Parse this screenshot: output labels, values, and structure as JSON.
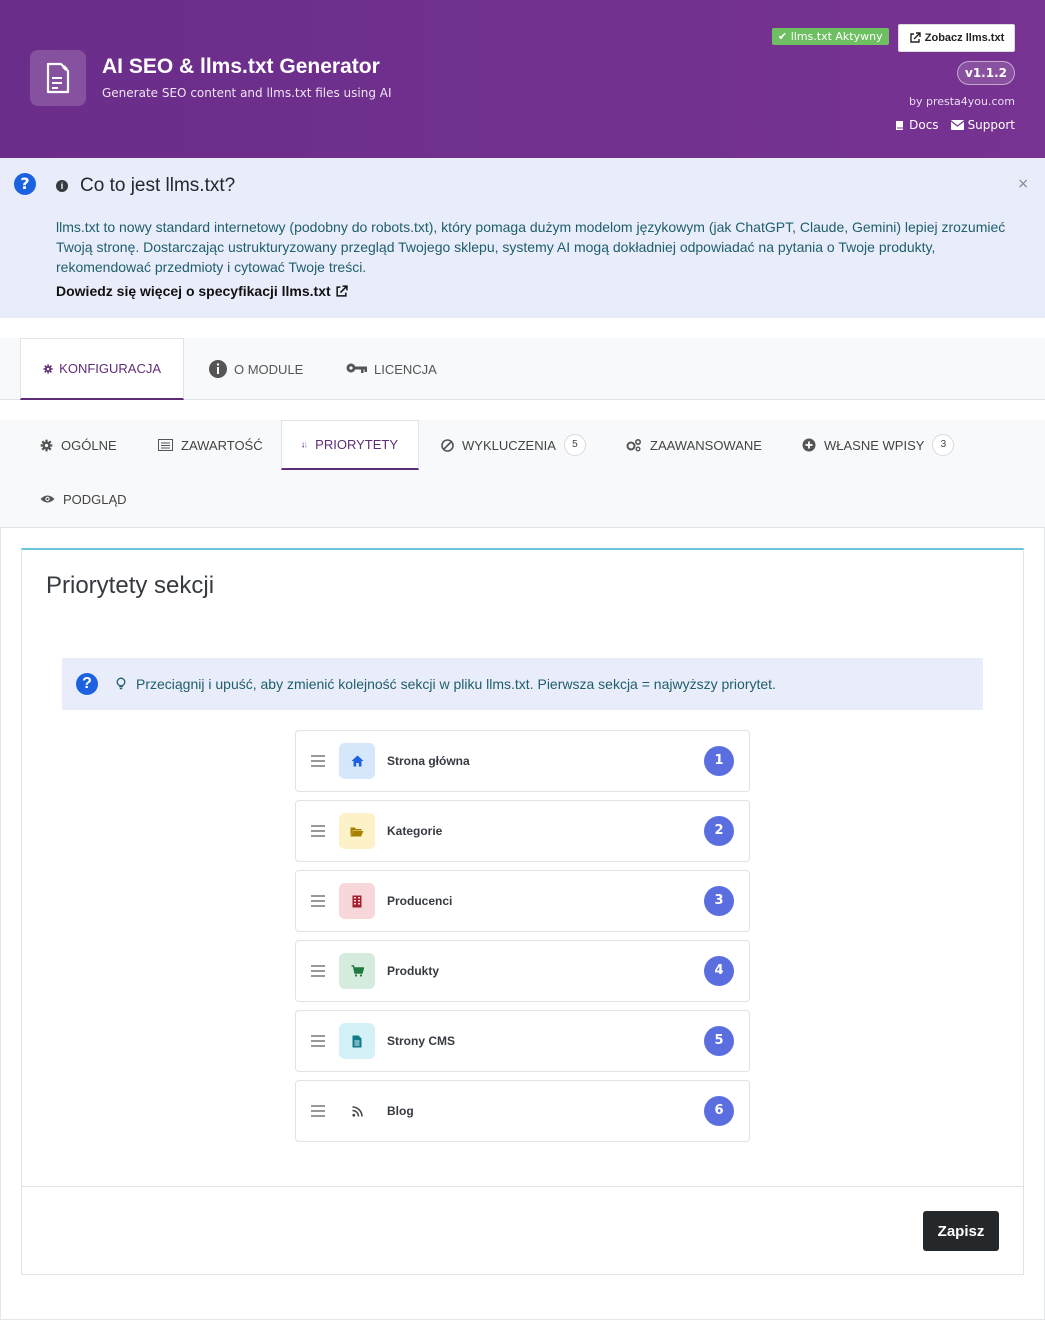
{
  "header": {
    "title": "AI SEO & llms.txt Generator",
    "subtitle": "Generate SEO content and llms.txt files using AI",
    "active_badge": "llms.txt Aktywny",
    "view_button": "Zobacz llms.txt",
    "version": "v1.1.2",
    "byline": "by presta4you.com",
    "docs_link": "Docs",
    "support_link": "Support",
    "brand_color": "#6b2d8a"
  },
  "info": {
    "title": "Co to jest llms.txt?",
    "text": "llms.txt to nowy standard internetowy (podobny do robots.txt), który pomaga dużym modelom językowym (jak ChatGPT, Claude, Gemini) lepiej zrozumieć Twoją stronę. Dostarczając ustrukturyzowany przegląd Twojego sklepu, systemy AI mogą dokładniej odpowiadać na pytania o Twoje produkty, rekomendować przedmioty i cytować Twoje treści.",
    "link": "Dowiedz się więcej o specyfikacji llms.txt",
    "close": "×"
  },
  "main_tabs": [
    {
      "label": "KONFIGURACJA",
      "icon": "gear-icon",
      "active": true
    },
    {
      "label": "O MODULE",
      "icon": "info-icon",
      "active": false
    },
    {
      "label": "LICENCJA",
      "icon": "key-icon",
      "active": false
    }
  ],
  "sub_tabs": [
    {
      "label": "OGÓLNE",
      "icon": "gear-icon"
    },
    {
      "label": "ZAWARTOŚĆ",
      "icon": "list-icon"
    },
    {
      "label": "PRIORYTETY",
      "icon": "sort-icon",
      "active": true
    },
    {
      "label": "WYKLUCZENIA",
      "icon": "ban-icon",
      "count": "5"
    },
    {
      "label": "ZAAWANSOWANE",
      "icon": "cogs-icon"
    },
    {
      "label": "WŁASNE WPISY",
      "icon": "plus-circle-icon",
      "count": "3"
    },
    {
      "label": "PODGLĄD",
      "icon": "eye-icon"
    }
  ],
  "priorities": {
    "title": "Priorytety sekcji",
    "hint": "Przeciągnij i upuść, aby zmienić kolejność sekcji w pliku llms.txt. Pierwsza sekcja = najwyższy priorytet.",
    "items": [
      {
        "label": "Strona główna",
        "num": "1",
        "icon": "home-icon",
        "bg": "#d6e6fb",
        "fg": "#1c62e0"
      },
      {
        "label": "Kategorie",
        "num": "2",
        "icon": "folder-icon",
        "bg": "#fdf1c8",
        "fg": "#a88000"
      },
      {
        "label": "Producenci",
        "num": "3",
        "icon": "building-icon",
        "bg": "#f8d7da",
        "fg": "#a02030"
      },
      {
        "label": "Produkty",
        "num": "4",
        "icon": "cart-icon",
        "bg": "#d5ebdd",
        "fg": "#1f7a3f"
      },
      {
        "label": "Strony CMS",
        "num": "5",
        "icon": "file-icon",
        "bg": "#d3f1f6",
        "fg": "#137a8a"
      },
      {
        "label": "Blog",
        "num": "6",
        "icon": "rss-icon",
        "bg": "#ffffff",
        "fg": "#444444"
      }
    ],
    "save": "Zapisz"
  }
}
